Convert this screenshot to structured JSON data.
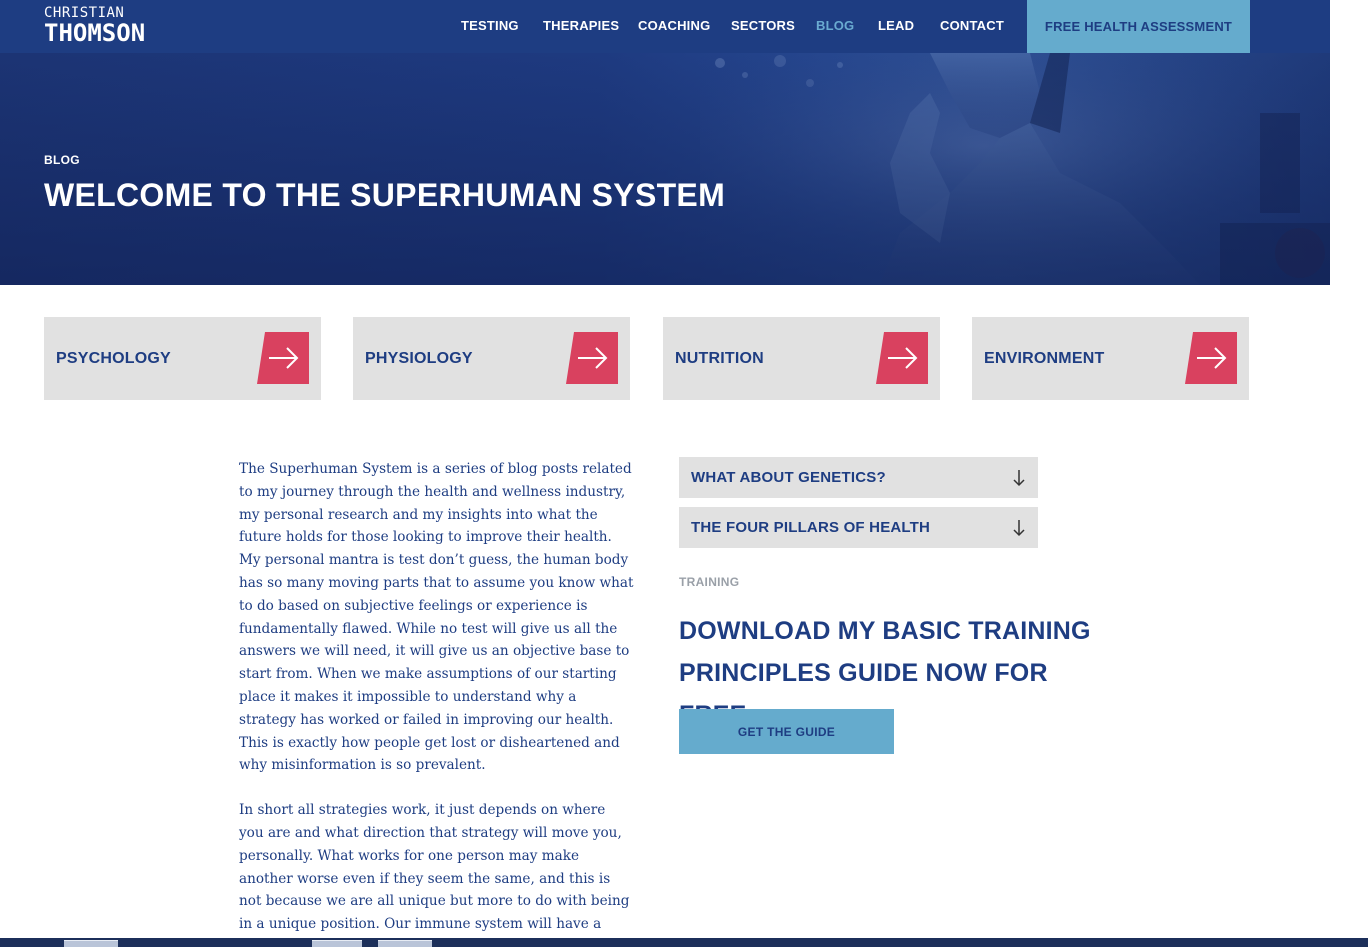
{
  "header": {
    "logo_top": "CHRISTIAN",
    "logo_bottom": "THOMSON",
    "nav": [
      {
        "label": "TESTING",
        "active": false
      },
      {
        "label": "THERAPIES",
        "active": false
      },
      {
        "label": "COACHING",
        "active": false
      },
      {
        "label": "SECTORS",
        "active": false
      },
      {
        "label": "BLOG",
        "active": true
      },
      {
        "label": "LEAD",
        "active": false
      },
      {
        "label": "CONTACT",
        "active": false
      }
    ],
    "cta_label": "FREE HEALTH ASSESSMENT"
  },
  "hero": {
    "kicker": "BLOG",
    "title": "WELCOME TO THE SUPERHUMAN SYSTEM"
  },
  "categories": [
    {
      "label": "PSYCHOLOGY",
      "icon": "arrow-right-icon"
    },
    {
      "label": "PHYSIOLOGY",
      "icon": "arrow-right-icon"
    },
    {
      "label": "NUTRITION",
      "icon": "arrow-right-icon"
    },
    {
      "label": "ENVIRONMENT",
      "icon": "arrow-right-icon"
    }
  ],
  "article": {
    "paragraphs": [
      "The Superhuman System is a series of blog posts related to my journey through the health and wellness industry, my personal research and my insights into what the future holds for those looking to improve their health. My personal mantra is test don’t guess, the human body has so many moving parts that to assume you know what to do based on subjective feelings or experience is fundamentally flawed. While no test will give us all the answers we will need, it will give us an objective base to start from. When we make assumptions of our starting place it makes it impossible to understand why a strategy has worked or failed in improving our health. This is exactly how people get lost or disheartened and why misinformation is so prevalent.",
      "In short all strategies work, it just depends on where you are and what direction that strategy will move you, personally. What works for one person may make another worse even if they seem the same, and this is not because we are all unique but more to do with being in a unique position. Our immune system will have a unique reactivity"
    ]
  },
  "sidebar": {
    "accordions": [
      {
        "label": "WHAT ABOUT GENETICS?",
        "icon": "arrow-down-icon"
      },
      {
        "label": "THE FOUR PILLARS OF HEALTH",
        "icon": "arrow-down-icon"
      }
    ],
    "training_kicker": "TRAINING",
    "training_title": "DOWNLOAD MY BASIC TRAINING PRINCIPLES GUIDE NOW FOR FREE",
    "guide_button": "GET THE GUIDE"
  },
  "colors": {
    "brand_navy": "#1e3d82",
    "accent_blue": "#65abcd",
    "accent_red": "#d9415f",
    "tile_grey": "#e1e1e1"
  }
}
